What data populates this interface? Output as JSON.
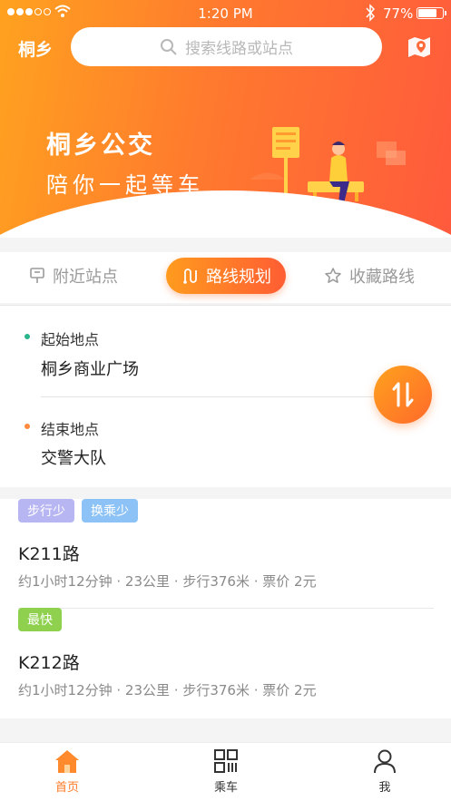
{
  "status_bar": {
    "time": "1:20 PM",
    "battery": "77%",
    "battery_level": 0.77,
    "signal_bars_filled": 3,
    "signal_bars_total": 5
  },
  "header": {
    "city": "桐乡",
    "search_placeholder": "搜索线路或站点",
    "map_icon": "map-pin-icon"
  },
  "banner": {
    "title": "桐乡公交",
    "subtitle": "陪你一起等车"
  },
  "tabs": [
    {
      "label": "附近站点",
      "icon": "bus-stop-icon",
      "active": false
    },
    {
      "label": "路线规划",
      "icon": "route-icon",
      "active": true
    },
    {
      "label": "收藏路线",
      "icon": "star-icon",
      "active": false
    }
  ],
  "form": {
    "start_label": "起始地点",
    "start_value": "桐乡商业广场",
    "end_label": "结束地点",
    "end_value": "交警大队",
    "start_color": "#2bb58d",
    "end_color": "#ff8a3d"
  },
  "results": [
    {
      "tags": [
        {
          "text": "步行少",
          "color": "#b8b6f2"
        },
        {
          "text": "换乘少",
          "color": "#8cc2f5"
        }
      ],
      "name": "K211路",
      "info": "约1小时12分钟 · 23公里 · 步行376米 · 票价  2元"
    },
    {
      "tags": [
        {
          "text": "最快",
          "color": "#8fd14f"
        }
      ],
      "name": "K212路",
      "info": "约1小时12分钟 · 23公里 · 步行376米 · 票价  2元"
    }
  ],
  "nav": [
    {
      "label": "首页",
      "icon": "home-icon",
      "active": true
    },
    {
      "label": "乘车",
      "icon": "qr-code-icon",
      "active": false
    },
    {
      "label": "我",
      "icon": "user-icon",
      "active": false
    }
  ],
  "colors": {
    "accent": "#ff7a28",
    "accent_gradient_start": "#ffa21f",
    "accent_gradient_end": "#ff5a3c"
  }
}
